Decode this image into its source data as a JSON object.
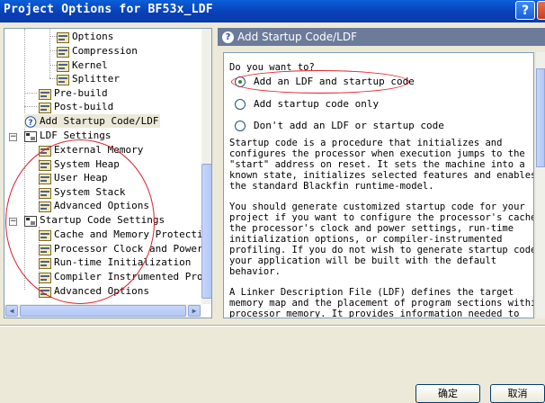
{
  "window": {
    "title": "Project Options for BF53x_LDF"
  },
  "tree": {
    "items": [
      {
        "label": "Options"
      },
      {
        "label": "Compression"
      },
      {
        "label": "Kernel"
      },
      {
        "label": "Splitter"
      },
      {
        "label": "Pre-build"
      },
      {
        "label": "Post-build"
      },
      {
        "label": "Add Startup Code/LDF"
      },
      {
        "label": "LDF Settings"
      },
      {
        "label": "External Memory"
      },
      {
        "label": "System Heap"
      },
      {
        "label": "User Heap"
      },
      {
        "label": "System Stack"
      },
      {
        "label": "Advanced Options"
      },
      {
        "label": "Startup Code Settings"
      },
      {
        "label": "Cache and Memory Protectio"
      },
      {
        "label": "Processor Clock and Power S"
      },
      {
        "label": "Run-time Initialization"
      },
      {
        "label": "Compiler Instrumented Prof"
      },
      {
        "label": "Advanced Options"
      }
    ]
  },
  "panel": {
    "title": "Add Startup Code/LDF",
    "question": "Do you want to?",
    "options": [
      {
        "label": "Add an LDF and startup code",
        "selected": true
      },
      {
        "label": "Add startup code only",
        "selected": false
      },
      {
        "label": "Don't add an LDF or startup code",
        "selected": false
      }
    ],
    "para1": [
      "Startup code is a procedure that initializes and",
      "configures the processor when execution jumps to the",
      "\"start\" address on reset. It sets the machine into a",
      "known state, initializes selected features and enables",
      "the standard Blackfin runtime-model."
    ],
    "para2": [
      "You should generate customized startup code for your",
      "project if you want to configure the processor's cache,",
      "the processor's clock and power settings, run-time",
      "initialization options, or compiler-instrumented",
      "profiling. If you do not wish to generate startup code,",
      "your application will be built with the default",
      "behavior."
    ],
    "para3": [
      "A Linker Description File (LDF) defines the target",
      "memory map and the placement of program sections within",
      "processor memory. It provides information needed to"
    ]
  },
  "buttons": {
    "ok": "确定",
    "cancel": "取消"
  },
  "colors": {
    "titlebar": "#0a5fd8",
    "header": "#6c7b9a",
    "annotation": "#e0202a"
  }
}
